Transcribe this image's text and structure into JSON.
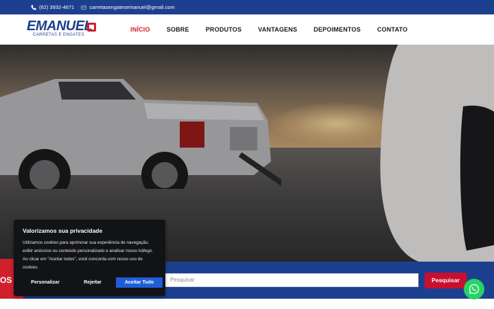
{
  "topbar": {
    "phone": "(62) 3932-4671",
    "email": "carretasengatesemanuel@gmail.com"
  },
  "logo": {
    "main": "EMANUEL",
    "sub": "CARRETAS E ENGATES"
  },
  "nav": {
    "items": [
      "INÍCIO",
      "SOBRE",
      "PRODUTOS",
      "VANTAGENS",
      "DEPOIMENTOS",
      "CONTATO"
    ],
    "active": "INÍCIO"
  },
  "search": {
    "left_label": "OS",
    "placeholder": "Pesquisar",
    "button": "Pesquisar"
  },
  "cookie": {
    "title": "Valorizamos sua privacidade",
    "text": "Utilizamos cookies para aprimorar sua experiência de navegação, exibir anúncios ou conteúdo personalizado e analisar nosso tráfego. Ao clicar em \"Aceitar todos\", você concorda com nosso uso de cookies.",
    "personalize": "Personalizar",
    "reject": "Rejeitar",
    "accept": "Aceitar Tudo"
  },
  "colors": {
    "brand_blue": "#1d3f8f",
    "brand_red": "#d0202e",
    "accept_blue": "#1e5ed8",
    "whatsapp_green": "#25d366"
  },
  "icons": [
    "phone-icon",
    "mail-icon",
    "whatsapp-icon"
  ]
}
